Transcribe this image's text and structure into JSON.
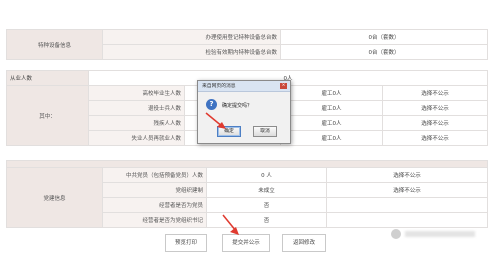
{
  "equipment": {
    "section_label": "特种设备信息",
    "rows": [
      {
        "label": "办理使用登记特种设备总台数",
        "value": "0台（套数）"
      },
      {
        "label": "检验有效期内特种设备总台数",
        "value": "0台（套数）"
      }
    ]
  },
  "employees": {
    "header_label": "从业人数",
    "header_value": "0人",
    "sub_section_label": "其中：",
    "rows": [
      {
        "label": "高校毕业生人数",
        "hire": "雇工0人",
        "publicity": "选择不公示"
      },
      {
        "label": "退役士兵人数",
        "hire": "雇工0人",
        "publicity": "选择不公示"
      },
      {
        "label": "残疾人人数",
        "hire": "雇工0人",
        "publicity": "选择不公示"
      },
      {
        "label": "失业人员再就业人数",
        "hire": "雇工0人",
        "publicity": "选择不公示"
      }
    ]
  },
  "party": {
    "section_label": "党建信息",
    "rows": [
      {
        "label": "中共党员（包括预备党员）人数",
        "value": "0 人",
        "publicity": "选择不公示"
      },
      {
        "label": "党组织建制",
        "value": "未成立",
        "publicity": "选择不公示"
      },
      {
        "label": "经营者是否为党员",
        "value": "否",
        "publicity": ""
      },
      {
        "label": "经营者是否为党组织书记",
        "value": "否",
        "publicity": ""
      }
    ]
  },
  "dialog": {
    "title": "来自网页的消息",
    "close_symbol": "×",
    "icon_symbol": "?",
    "message": "确定提交吗？",
    "ok_label": "确定",
    "cancel_label": "取消"
  },
  "actions": {
    "preview_label": "预览打印",
    "submit_label": "提交并公示",
    "back_label": "返回修改"
  },
  "annotation_color": "#e03a2f"
}
